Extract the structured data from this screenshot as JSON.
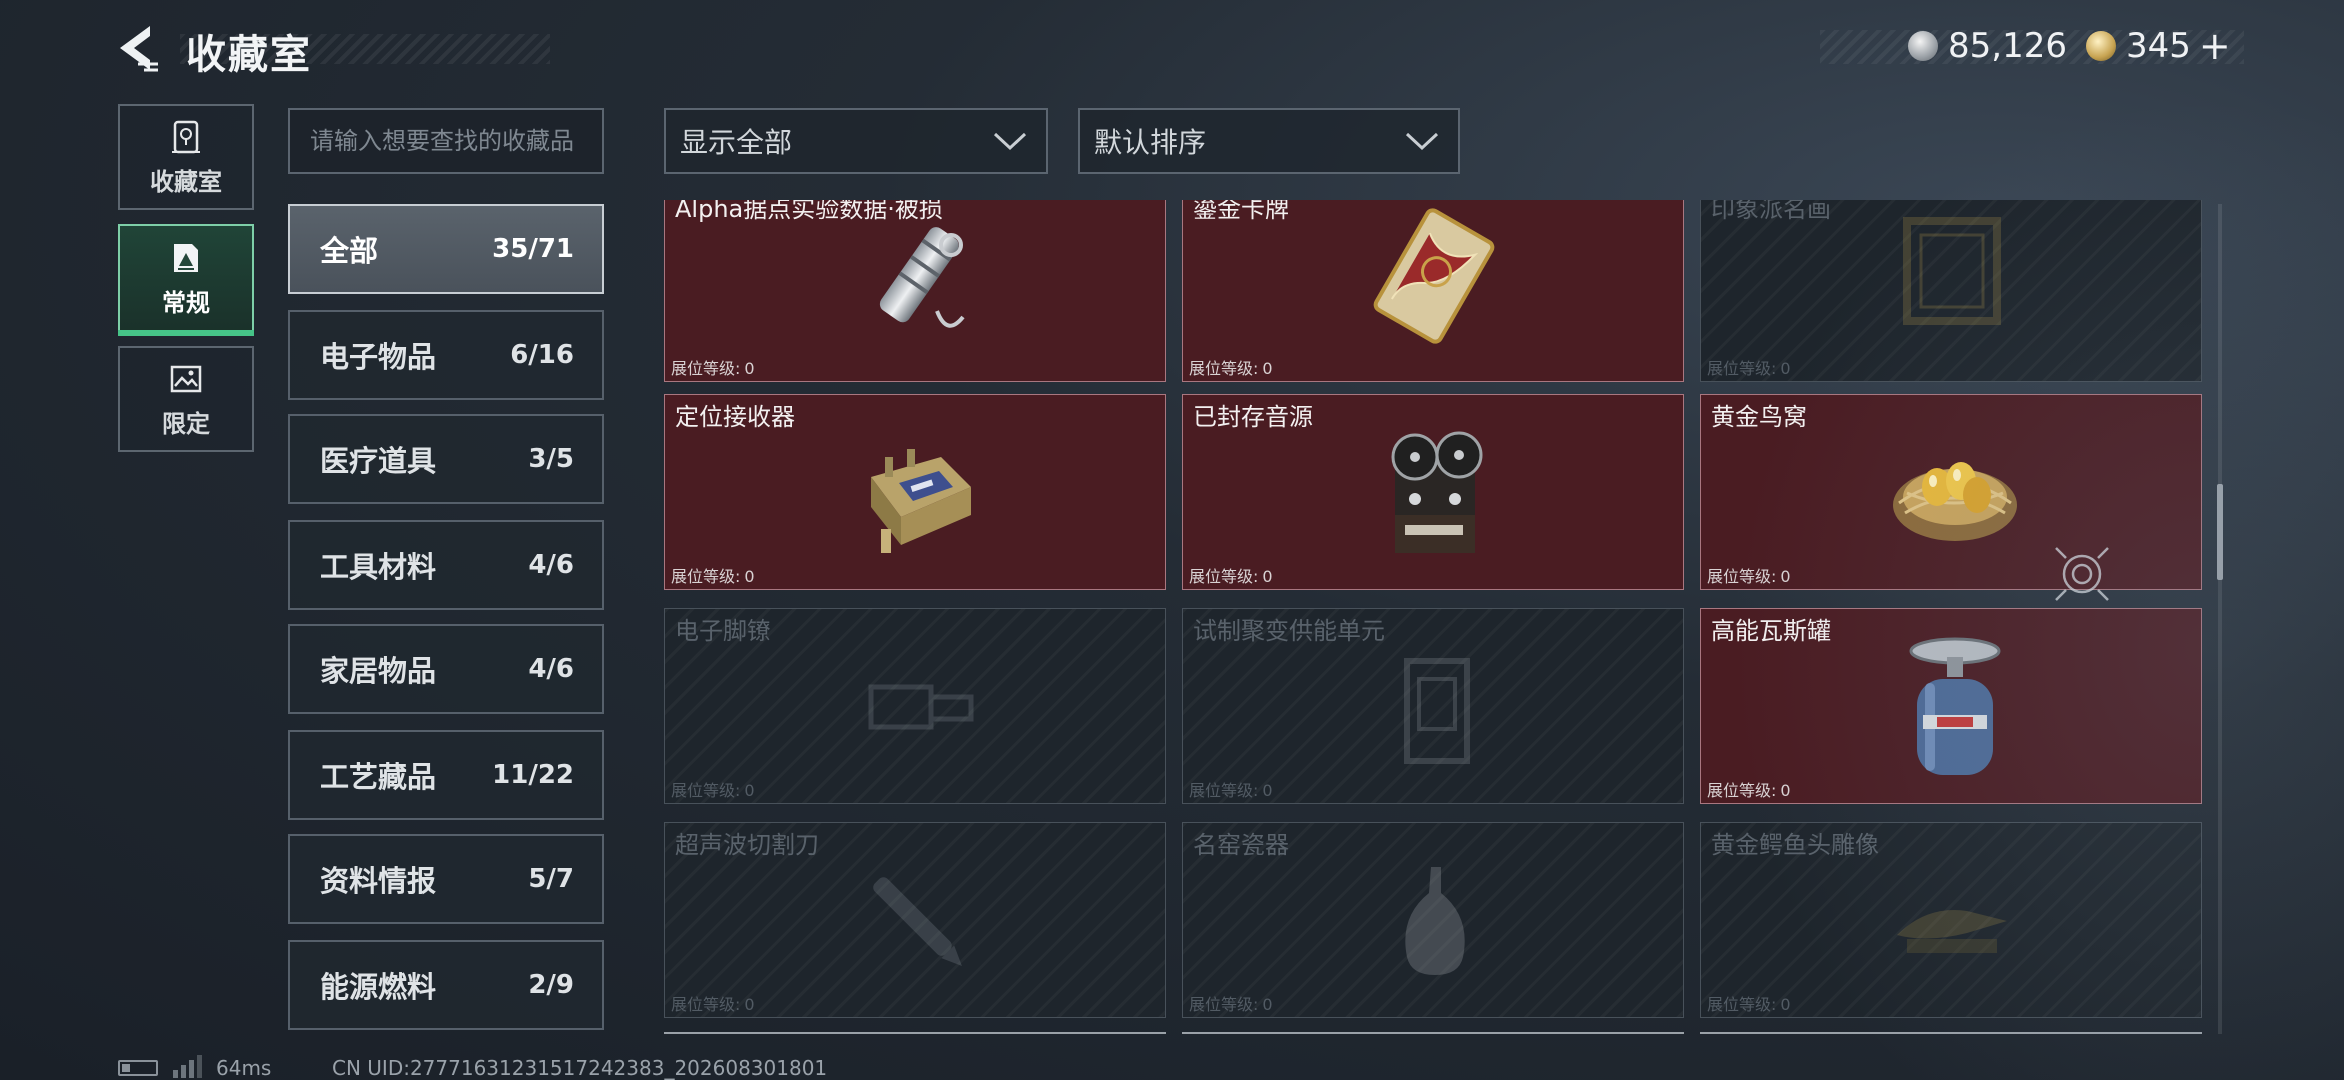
{
  "header": {
    "title": "收藏室",
    "currency": [
      {
        "icon": "silver-coin-icon",
        "value": "85,126"
      },
      {
        "icon": "gold-coin-icon",
        "value": "345"
      }
    ],
    "plus_label": "+"
  },
  "side_tabs": [
    {
      "label": "收藏室",
      "icon": "vault-icon",
      "active": false
    },
    {
      "label": "常规",
      "icon": "portrait-icon",
      "active": true
    },
    {
      "label": "限定",
      "icon": "landscape-icon",
      "active": false
    }
  ],
  "search": {
    "placeholder": "请输入想要查找的收藏品"
  },
  "categories": [
    {
      "name": "全部",
      "count": "35/71",
      "active": true
    },
    {
      "name": "电子物品",
      "count": "6/16"
    },
    {
      "name": "医疗道具",
      "count": "3/5"
    },
    {
      "name": "工具材料",
      "count": "4/6"
    },
    {
      "name": "家居物品",
      "count": "4/6"
    },
    {
      "name": "工艺藏品",
      "count": "11/22"
    },
    {
      "name": "资料情报",
      "count": "5/7"
    },
    {
      "name": "能源燃料",
      "count": "2/9"
    }
  ],
  "filters": {
    "show": "显示全部",
    "sort": "默认排序"
  },
  "level_label": "展位等级:",
  "items": [
    {
      "name": "Alpha据点实验数据·被损",
      "level": "0",
      "owned": true,
      "icon": "flashlight-keychain-icon"
    },
    {
      "name": "鎏金卡牌",
      "level": "0",
      "owned": true,
      "icon": "gilded-card-icon"
    },
    {
      "name": "印象派名画",
      "level": "0",
      "owned": false,
      "icon": "painting-frame-icon"
    },
    {
      "name": "定位接收器",
      "level": "0",
      "owned": true,
      "icon": "receiver-icon"
    },
    {
      "name": "已封存音源",
      "level": "0",
      "owned": true,
      "icon": "reel-to-reel-icon"
    },
    {
      "name": "黄金鸟窝",
      "level": "0",
      "owned": true,
      "icon": "golden-nest-icon"
    },
    {
      "name": "电子脚镣",
      "level": "0",
      "owned": false,
      "icon": "ankle-monitor-icon"
    },
    {
      "name": "试制聚变供能单元",
      "level": "0",
      "owned": false,
      "icon": "fusion-cell-icon"
    },
    {
      "name": "高能瓦斯罐",
      "level": "0",
      "owned": true,
      "icon": "gas-canister-icon"
    },
    {
      "name": "超声波切割刀",
      "level": "0",
      "owned": false,
      "icon": "cutter-icon"
    },
    {
      "name": "名窑瓷器",
      "level": "0",
      "owned": false,
      "icon": "porcelain-vase-icon"
    },
    {
      "name": "黄金鳄鱼头雕像",
      "level": "0",
      "owned": false,
      "icon": "gold-crocodile-statue-icon"
    }
  ],
  "footer": {
    "ping": "64ms",
    "uid": "CN UID:27771631231517242383_202608301801"
  },
  "colors": {
    "owned_card": "#4a1c22",
    "locked_card": "#1e252c",
    "active_tab_accent": "#46c488"
  }
}
